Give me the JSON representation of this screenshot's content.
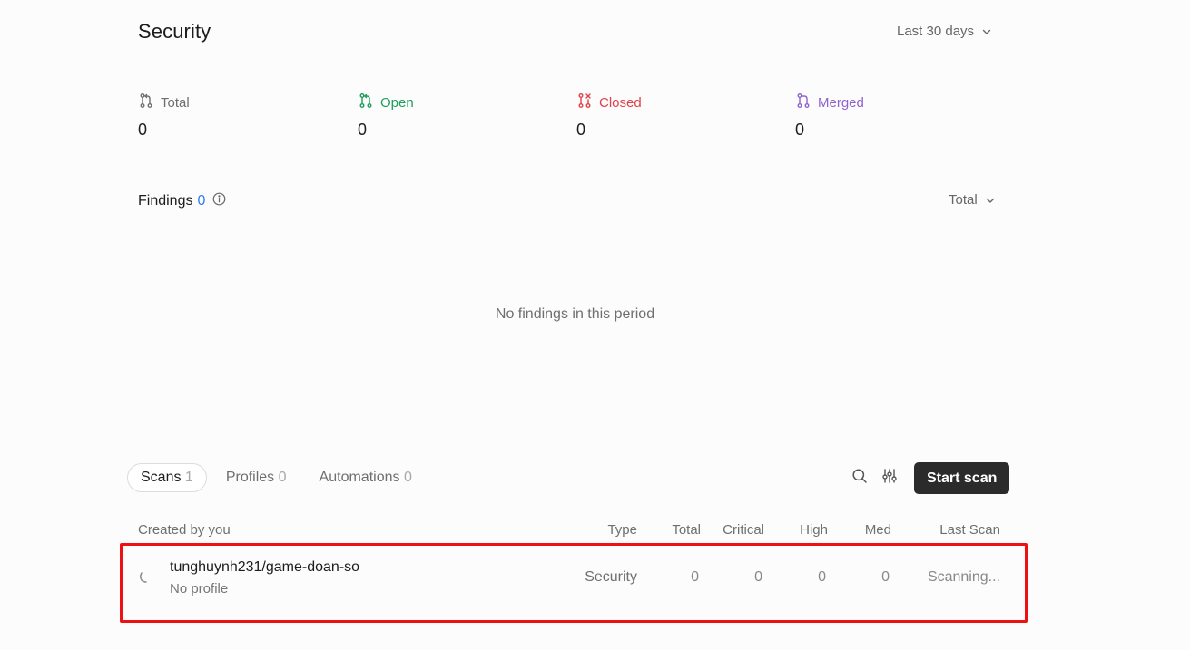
{
  "header": {
    "title": "Security",
    "period": "Last 30 days"
  },
  "stats": [
    {
      "label": "Total",
      "value": "0",
      "color": "#6f6f6f",
      "icon": "pull-request-icon"
    },
    {
      "label": "Open",
      "value": "0",
      "color": "#1e9e5a",
      "icon": "pull-request-open-icon"
    },
    {
      "label": "Closed",
      "value": "0",
      "color": "#e0424a",
      "icon": "pull-request-closed-icon"
    },
    {
      "label": "Merged",
      "value": "0",
      "color": "#8e63ce",
      "icon": "pull-request-merged-icon"
    }
  ],
  "findings": {
    "title": "Findings",
    "count": "0",
    "selector": "Total",
    "empty": "No findings in this period"
  },
  "tabs": [
    {
      "label": "Scans",
      "count": "1",
      "active": true
    },
    {
      "label": "Profiles",
      "count": "0",
      "active": false
    },
    {
      "label": "Automations",
      "count": "0",
      "active": false
    }
  ],
  "toolbar": {
    "start_label": "Start scan",
    "search_icon": "search-icon",
    "filter_icon": "filter-sliders-icon"
  },
  "table": {
    "headers": {
      "created": "Created by you",
      "type": "Type",
      "total": "Total",
      "critical": "Critical",
      "high": "High",
      "med": "Med",
      "last": "Last Scan"
    },
    "rows": [
      {
        "name": "tunghuynh231/game-doan-so",
        "profile": "No profile",
        "type": "Security",
        "total": "0",
        "critical": "0",
        "high": "0",
        "med": "0",
        "last": "Scanning..."
      }
    ]
  },
  "colors": {
    "accent": "#2f7bf5",
    "highlight": "#ee1111",
    "button": "#2b2b2b"
  }
}
